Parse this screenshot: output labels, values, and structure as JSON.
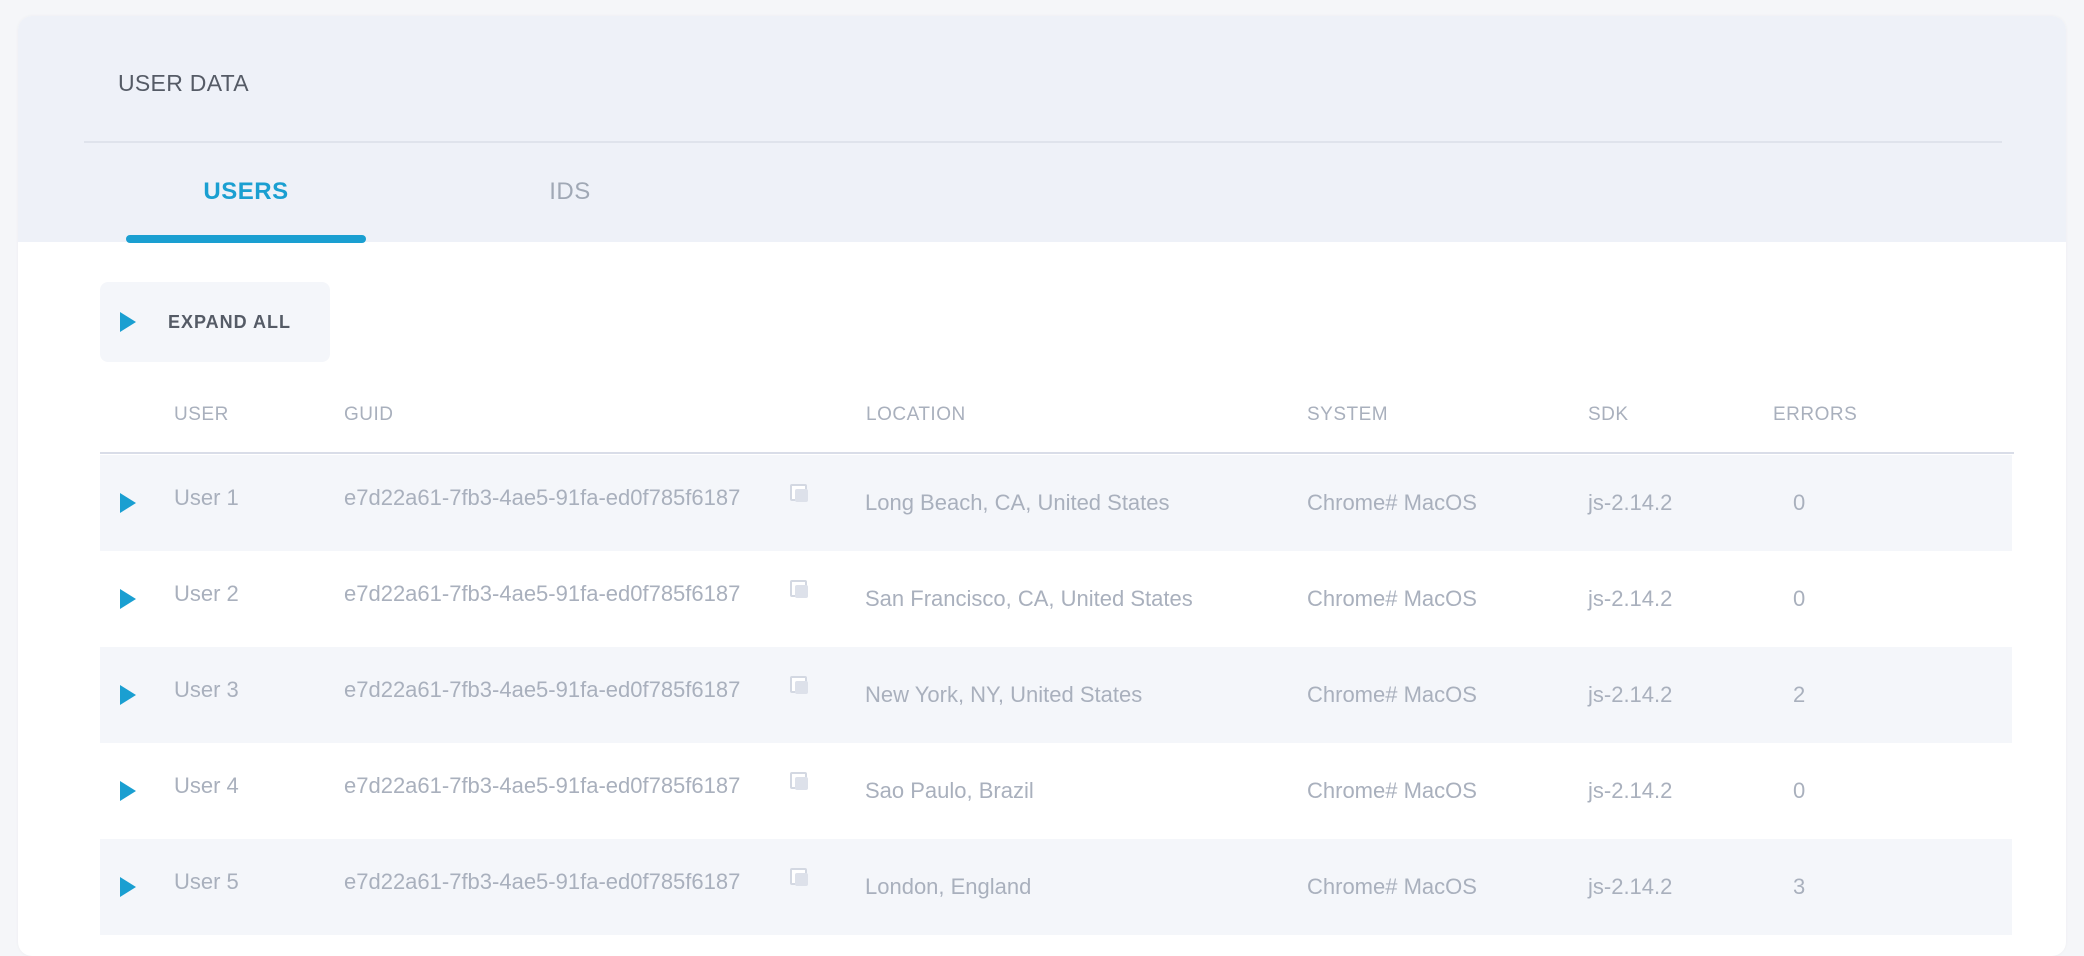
{
  "panel": {
    "title": "USER DATA"
  },
  "tabs": [
    {
      "label": "USERS",
      "active": true
    },
    {
      "label": "IDS",
      "active": false
    }
  ],
  "toolbar": {
    "expand_all_label": "EXPAND ALL"
  },
  "table": {
    "columns": [
      "USER",
      "GUID",
      "LOCATION",
      "SYSTEM",
      "SDK",
      "ERRORS"
    ],
    "rows": [
      {
        "user": "User 1",
        "guid": "e7d22a61-7fb3-4ae5-91fa-ed0f785f6187",
        "location": "Long Beach, CA, United States",
        "system": "Chrome# MacOS",
        "sdk": "js-2.14.2",
        "errors": "0"
      },
      {
        "user": "User 2",
        "guid": "e7d22a61-7fb3-4ae5-91fa-ed0f785f6187",
        "location": "San Francisco, CA, United States",
        "system": "Chrome# MacOS",
        "sdk": "js-2.14.2",
        "errors": "0"
      },
      {
        "user": "User 3",
        "guid": "e7d22a61-7fb3-4ae5-91fa-ed0f785f6187",
        "location": "New York, NY, United States",
        "system": "Chrome# MacOS",
        "sdk": "js-2.14.2",
        "errors": "2"
      },
      {
        "user": "User 4",
        "guid": "e7d22a61-7fb3-4ae5-91fa-ed0f785f6187",
        "location": "Sao Paulo, Brazil",
        "system": "Chrome# MacOS",
        "sdk": "js-2.14.2",
        "errors": "0"
      },
      {
        "user": "User 5",
        "guid": "e7d22a61-7fb3-4ae5-91fa-ed0f785f6187",
        "location": "London, England",
        "system": "Chrome# MacOS",
        "sdk": "js-2.14.2",
        "errors": "3"
      }
    ]
  },
  "icons": {
    "expand": "play-icon",
    "copy": "copy-icon"
  },
  "colors": {
    "accent": "#1a9fd1",
    "header_bg": "#eef1f8",
    "muted_text": "#a9b0bd"
  }
}
